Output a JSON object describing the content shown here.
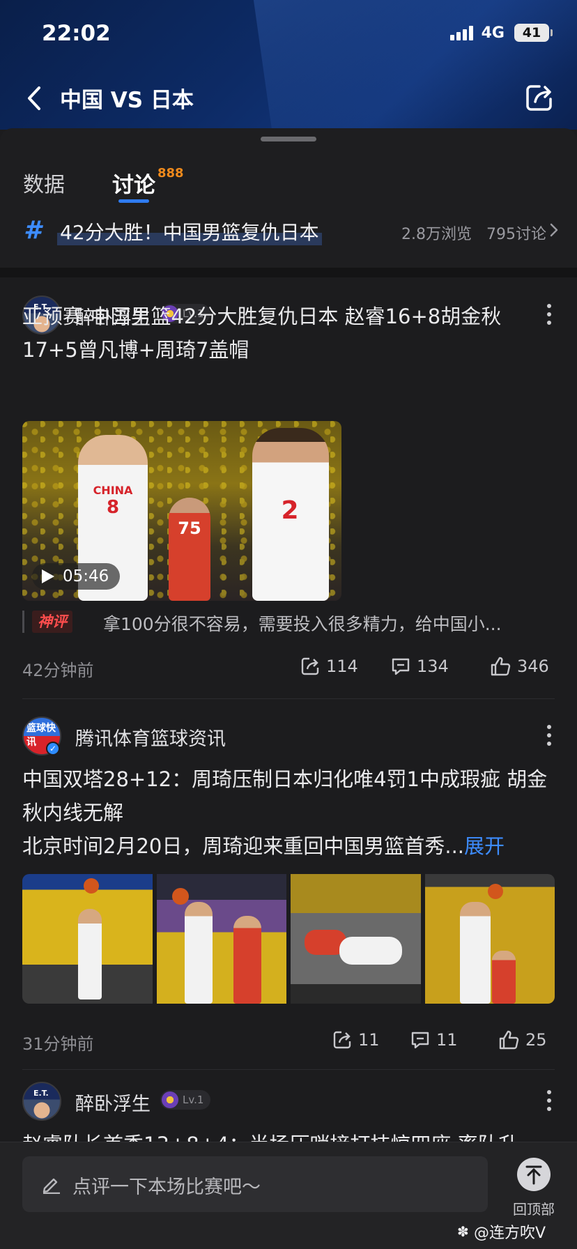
{
  "status_bar": {
    "time": "22:02",
    "network": "4G",
    "battery": "41"
  },
  "nav": {
    "title": "中国 VS 日本"
  },
  "tabs": [
    {
      "label": "数据"
    },
    {
      "label": "讨论",
      "badge": "888"
    }
  ],
  "topic": {
    "title": "42分大胜！中国男篮复仇日本",
    "views": "2.8万浏览",
    "discussions": "795讨论"
  },
  "posts": [
    {
      "author": "醉卧浮生",
      "level": "Lv.1",
      "text": "亚预赛-中国男篮42分大胜复仇日本 赵睿16+8胡金秋17+5曾凡博+周琦7盖帽",
      "video_duration": "05:46",
      "comment_tag": "神评",
      "comment": "拿100分很不容易，需要投入很多精力，给中国小...",
      "time": "42分钟前",
      "shares": "114",
      "comments": "134",
      "likes": "346"
    },
    {
      "author": "腾讯体育篮球资讯",
      "avatar_text": "篮球快讯",
      "text": "中国双塔28+12：周琦压制日本归化唯4罚1中成瑕疵 胡金秋内线无解",
      "summary": "北京时间2月20日，周琦迎来重回中国男篮首秀...",
      "expand": "展开",
      "time": "31分钟前",
      "shares": "11",
      "comments": "11",
      "likes": "25"
    },
    {
      "author": "醉卧浮生",
      "level": "Lv.1",
      "text": "赵睿队长首秀13+8+4：半场压哨接打技惊四座 率队升"
    }
  ],
  "bottom": {
    "input_placeholder": "点评一下本场比赛吧～",
    "back_to_top": "回顶部",
    "watermark": "@连方吹V"
  },
  "colors": {
    "accent": "#2f7bf0",
    "badge": "#f08a1c",
    "link": "#3d8cff",
    "shenping": "#ff4d4d"
  }
}
